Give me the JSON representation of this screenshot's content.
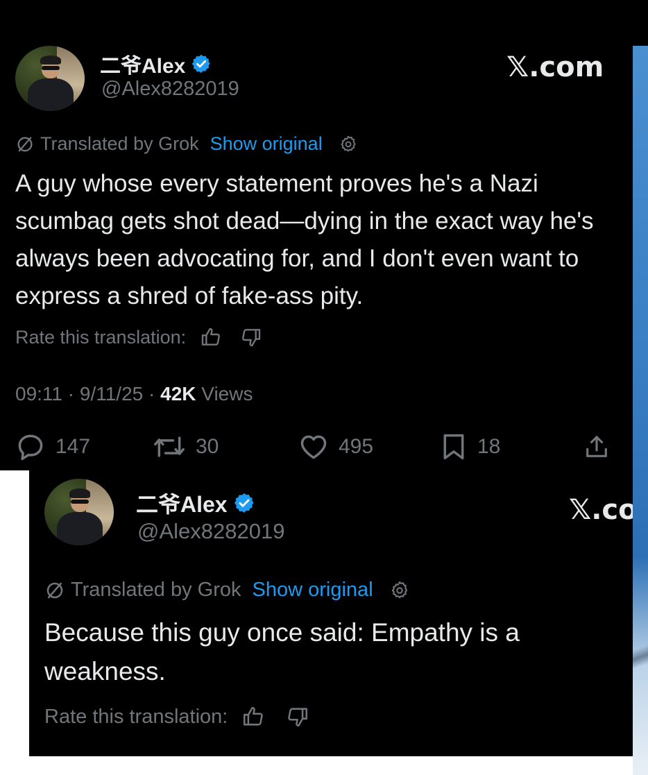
{
  "tweet1": {
    "display_name": "二爷Alex",
    "handle": "@Alex8282019",
    "brand": "𝕏.com",
    "translated_by": "Translated by Grok",
    "show_original": "Show original",
    "text": "A guy whose every statement proves he's a Nazi scumbag gets shot dead—dying in the exact way he's always been advocating for, and I don't even want to express a shred of fake-ass pity.",
    "rate_label": "Rate this translation:",
    "time": "09:11",
    "date": "9/11/25",
    "views_count": "42K",
    "views_label": "Views",
    "replies": "147",
    "reposts": "30",
    "likes": "495",
    "bookmarks": "18"
  },
  "tweet2": {
    "display_name": "二爷Alex",
    "handle": "@Alex8282019",
    "brand": "𝕏.co",
    "translated_by": "Translated by Grok",
    "show_original": "Show original",
    "text": "Because this guy once said: Empathy is a weakness.",
    "rate_label": "Rate this translation:"
  },
  "icons": {
    "verified": "verified-badge-icon",
    "translate": "translate-slash-icon",
    "settings": "gear-icon",
    "thumbs_up": "thumbs-up-icon",
    "thumbs_down": "thumbs-down-icon",
    "reply": "reply-icon",
    "repost": "repost-icon",
    "like": "heart-icon",
    "bookmark": "bookmark-icon",
    "share": "share-icon"
  },
  "colors": {
    "background": "#000000",
    "text": "#e7e9ea",
    "muted": "#71767b",
    "link": "#1d9bf0",
    "verified": "#1d9bf0"
  }
}
